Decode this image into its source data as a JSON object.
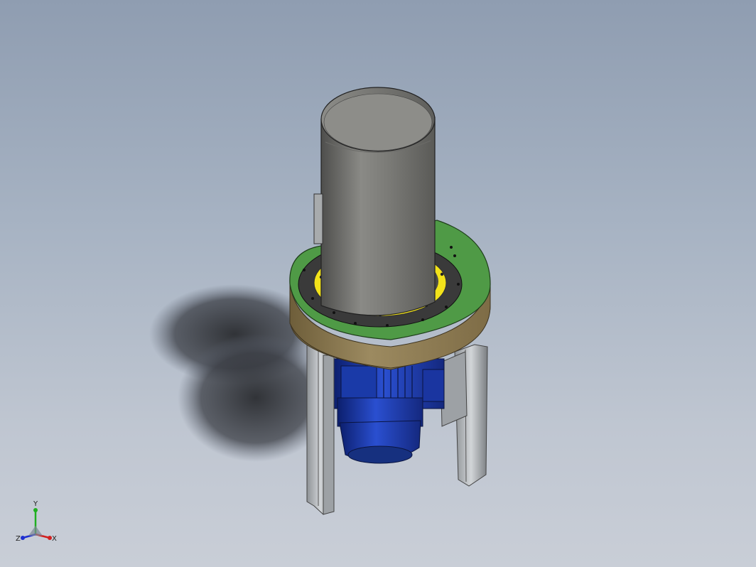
{
  "viewport": {
    "background_top": "#8f9db1",
    "background_bottom": "#c9ced7"
  },
  "model": {
    "parts": {
      "hopper": {
        "color": "#6e6e6a"
      },
      "top_ring": {
        "color": "#4f9a46"
      },
      "inner_ring": {
        "color": "#f2e21a"
      },
      "inner_plate": {
        "color": "#3a3a3a"
      },
      "housing_band": {
        "color": "#8c7a52"
      },
      "motor": {
        "color": "#1f3fb0"
      },
      "legs": {
        "color": "#b8bcc0"
      }
    }
  },
  "triad": {
    "x_label": "X",
    "y_label": "Y",
    "z_label": "Z",
    "x_color": "#d22020",
    "y_color": "#20b020",
    "z_color": "#2030d0"
  }
}
